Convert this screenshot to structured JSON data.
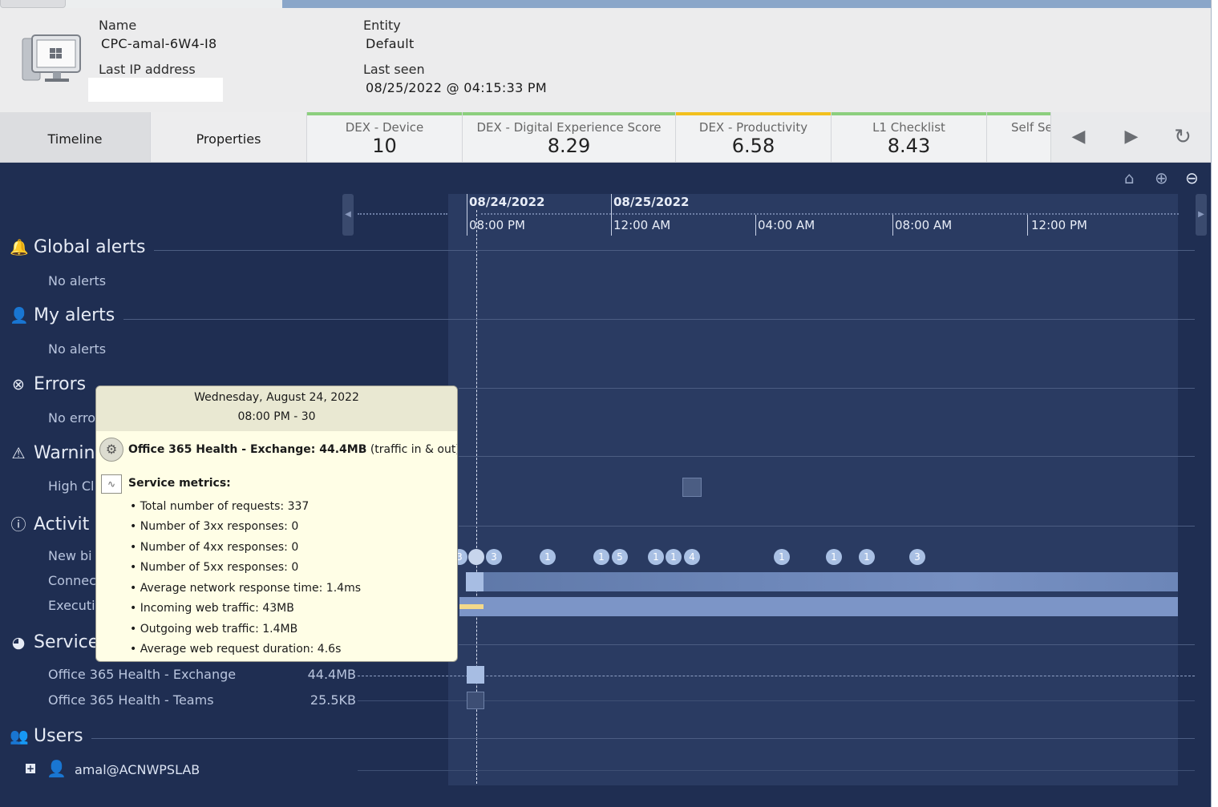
{
  "device": {
    "name_label": "Name",
    "name_value": "CPC-amal-6W4-I8",
    "ip_label": "Last IP address",
    "entity_label": "Entity",
    "entity_value": "Default",
    "last_seen_label": "Last seen",
    "last_seen_value": "08/25/2022 @ 04:15:33 PM",
    "icon": "windows-computer-icon"
  },
  "tabs": [
    {
      "label": "Timeline"
    },
    {
      "label": "Properties"
    }
  ],
  "scores": [
    {
      "label": "DEX - Device",
      "value": "10",
      "color": "#8ccf7e"
    },
    {
      "label": "DEX - Digital Experience Score",
      "value": "8.29",
      "color": "#8ccf7e"
    },
    {
      "label": "DEX - Productivity",
      "value": "6.58",
      "color": "#f2c01e"
    },
    {
      "label": "L1 Checklist",
      "value": "8.43",
      "color": "#8ccf7e"
    },
    {
      "label": "Self Se",
      "value": "",
      "color": "#8ccf7e"
    }
  ],
  "timeline": {
    "dates": [
      "08/24/2022",
      "08/25/2022"
    ],
    "times": [
      "08:00 PM",
      "12:00 AM",
      "04:00 AM",
      "08:00 AM",
      "12:00 PM"
    ]
  },
  "sections": {
    "global_alerts": {
      "title": "Global alerts",
      "sub": "No alerts"
    },
    "my_alerts": {
      "title": "My alerts",
      "sub": "No alerts"
    },
    "errors": {
      "title": "Errors",
      "sub": "No erro"
    },
    "warnings": {
      "title": "Warnin",
      "sub": "High Cl"
    },
    "activity": {
      "title": "Activit",
      "rows": [
        "New bi",
        "Connec",
        "Executi"
      ]
    },
    "services": {
      "title": "Service",
      "rows": [
        {
          "name": "Office 365 Health - Exchange",
          "value": "44.4MB"
        },
        {
          "name": "Office 365 Health - Teams",
          "value": "25.5KB"
        }
      ]
    },
    "users": {
      "title": "Users",
      "user": "amal@ACNWPSLAB"
    }
  },
  "bubbles": [
    "3",
    "",
    "3",
    "1",
    "1",
    "5",
    "1",
    "1",
    "4",
    "1",
    "1",
    "1",
    "3"
  ],
  "tooltip": {
    "date": "Wednesday, August 24, 2022",
    "time": "08:00 PM - 30",
    "title_bold": "Office 365 Health - Exchange: 44.4MB",
    "title_rest": " (traffic in & out)",
    "metrics_title": "Service metrics:",
    "metrics": [
      "Total number of requests: 337",
      "Number of 3xx responses: 0",
      "Number of 4xx responses: 0",
      "Number of 5xx responses: 0",
      "Average network response time: 1.4ms",
      "Incoming web traffic: 43MB",
      "Outgoing web traffic: 1.4MB",
      "Average web request duration: 4.6s"
    ]
  }
}
